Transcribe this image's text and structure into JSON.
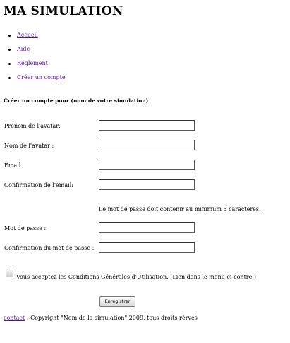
{
  "page": {
    "title": "MA SIMULATION"
  },
  "nav": {
    "items": [
      {
        "label": "Accueil"
      },
      {
        "label": "Aide"
      },
      {
        "label": "Réglement"
      },
      {
        "label": "Créer un compte"
      }
    ]
  },
  "form": {
    "heading": "Créer un compte pour (nom de votre simulation)",
    "fields": [
      {
        "label": "Prénom de l'avatar:",
        "value": ""
      },
      {
        "label": "Nom de l'avatar :",
        "value": ""
      },
      {
        "label": "Email",
        "value": ""
      },
      {
        "label": "Confirmation de l'email:",
        "value": ""
      },
      {
        "label": "Mot de passe :",
        "value": ""
      },
      {
        "label": "Confirmation du mot de passe :",
        "value": ""
      }
    ],
    "password_note": "Le mot de passe doit contenir au minimum 5 caractères.",
    "terms_label": "Vous acceptez les Conditions Générales d'Utilisation. (Lien dans le menu ci-contre.)",
    "submit_label": "Enregistrer"
  },
  "footer": {
    "link_label": "contact",
    "copyright": "--Copyright \"Nom de la simulation\" 2009, tous droits rérvés"
  }
}
